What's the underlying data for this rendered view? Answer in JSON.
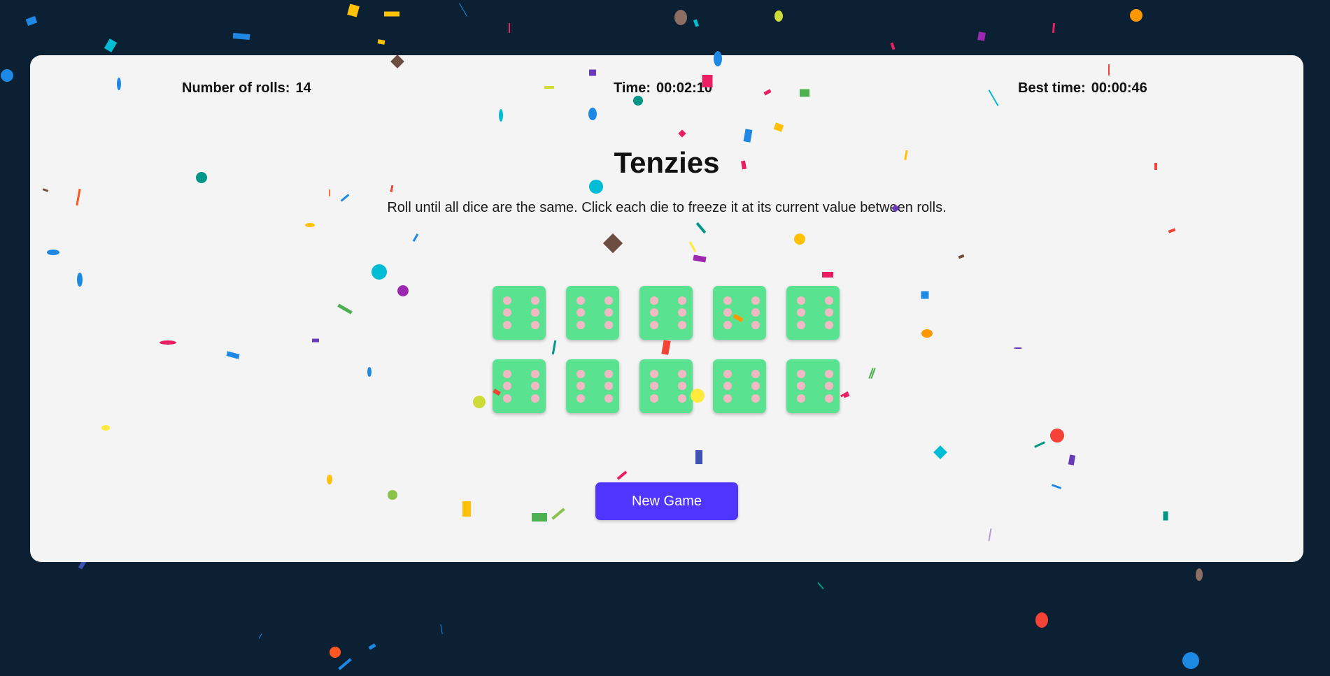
{
  "stats": {
    "rolls_label": "Number of rolls:",
    "rolls_value": "14",
    "time_label": "Time:",
    "time_value": "00:02:10",
    "best_label": "Best time:",
    "best_value": "00:00:46"
  },
  "game": {
    "title": "Tenzies",
    "instructions": "Roll until all dice are the same. Click each die to freeze it at its current value between rolls."
  },
  "dice": [
    {
      "value": 6,
      "held": true
    },
    {
      "value": 6,
      "held": true
    },
    {
      "value": 6,
      "held": true
    },
    {
      "value": 6,
      "held": true
    },
    {
      "value": 6,
      "held": true
    },
    {
      "value": 6,
      "held": true
    },
    {
      "value": 6,
      "held": true
    },
    {
      "value": 6,
      "held": true
    },
    {
      "value": 6,
      "held": true
    },
    {
      "value": 6,
      "held": true
    }
  ],
  "controls": {
    "new_game_label": "New Game"
  },
  "colors": {
    "background": "#0b2133",
    "board": "#f4f4f4",
    "die_held": "#59e391",
    "pip": "#f2b8c4",
    "button": "#5035ff"
  },
  "overlay": "confetti"
}
